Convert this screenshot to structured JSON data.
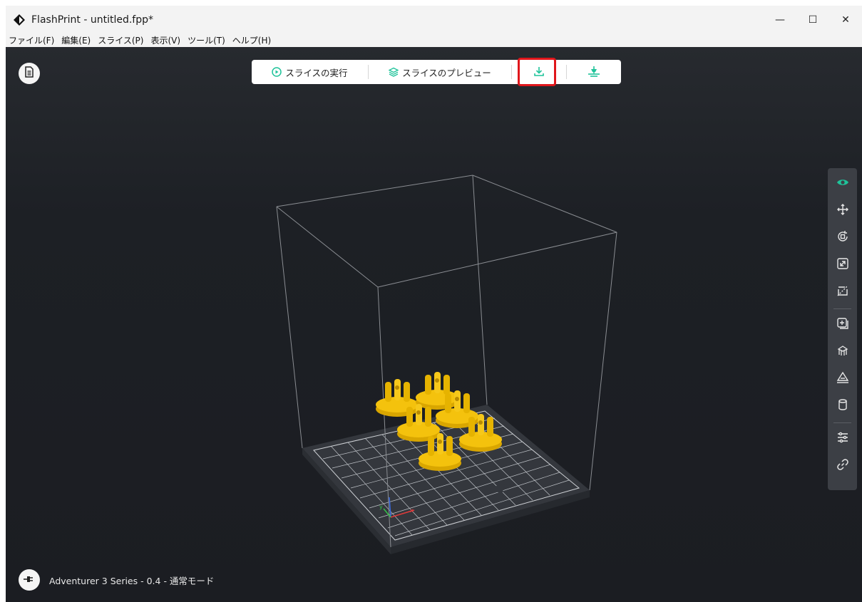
{
  "window": {
    "title": "FlashPrint - untitled.fpp*",
    "controls": {
      "minimize": "—",
      "maximize": "☐",
      "close": "✕"
    }
  },
  "menu": [
    {
      "label": "ファイル(F)"
    },
    {
      "label": "編集(E)"
    },
    {
      "label": "スライス(P)"
    },
    {
      "label": "表示(V)"
    },
    {
      "label": "ツール(T)"
    },
    {
      "label": "ヘルプ(H)"
    }
  ],
  "toolbar": {
    "run_slice": "スライスの実行",
    "preview_slice": "スライスのプレビュー",
    "export_icon": "download-icon",
    "printer_icon": "printer-connect-icon"
  },
  "right_panel": {
    "icons": [
      "view-icon",
      "move-icon",
      "rotate-icon",
      "scale-icon",
      "cut-icon",
      "add-icon",
      "supports-icon",
      "place-on-face-icon",
      "cylinder-icon",
      "settings-sliders-icon",
      "link-icon"
    ],
    "active": "view-icon"
  },
  "status": {
    "machine": "Adventurer 3 Series - 0.4 - 通常モード"
  },
  "colors": {
    "accent": "#1fc39a",
    "highlight": "#e0161b",
    "model": "#f4c20d",
    "viewport": "#1d2025"
  }
}
